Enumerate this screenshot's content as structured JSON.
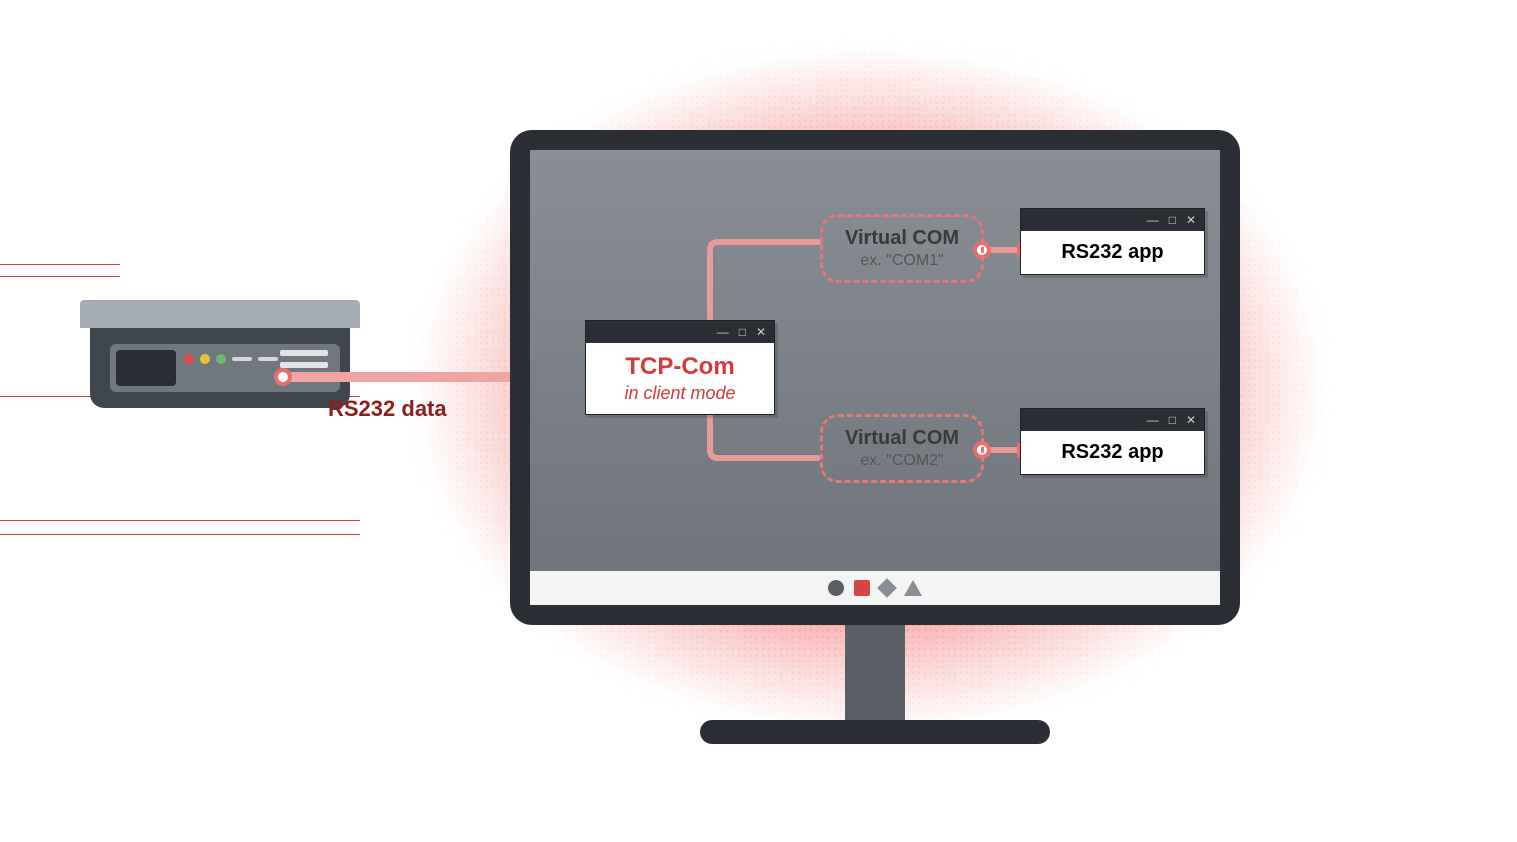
{
  "flow_label": "RS232 data",
  "tcp_box": {
    "title": "TCP-Com",
    "subtitle": "in client mode"
  },
  "virtual_com": [
    {
      "title": "Virtual COM",
      "example": "ex. \"COM1\""
    },
    {
      "title": "Virtual COM",
      "example": "ex. \"COM2\""
    }
  ],
  "app_windows": [
    {
      "label": "RS232 app"
    },
    {
      "label": "RS232 app"
    }
  ],
  "colors": {
    "accent_red": "#d43a3a",
    "glow_red": "#ea6c6c",
    "connector_pink": "#e89a9a"
  }
}
